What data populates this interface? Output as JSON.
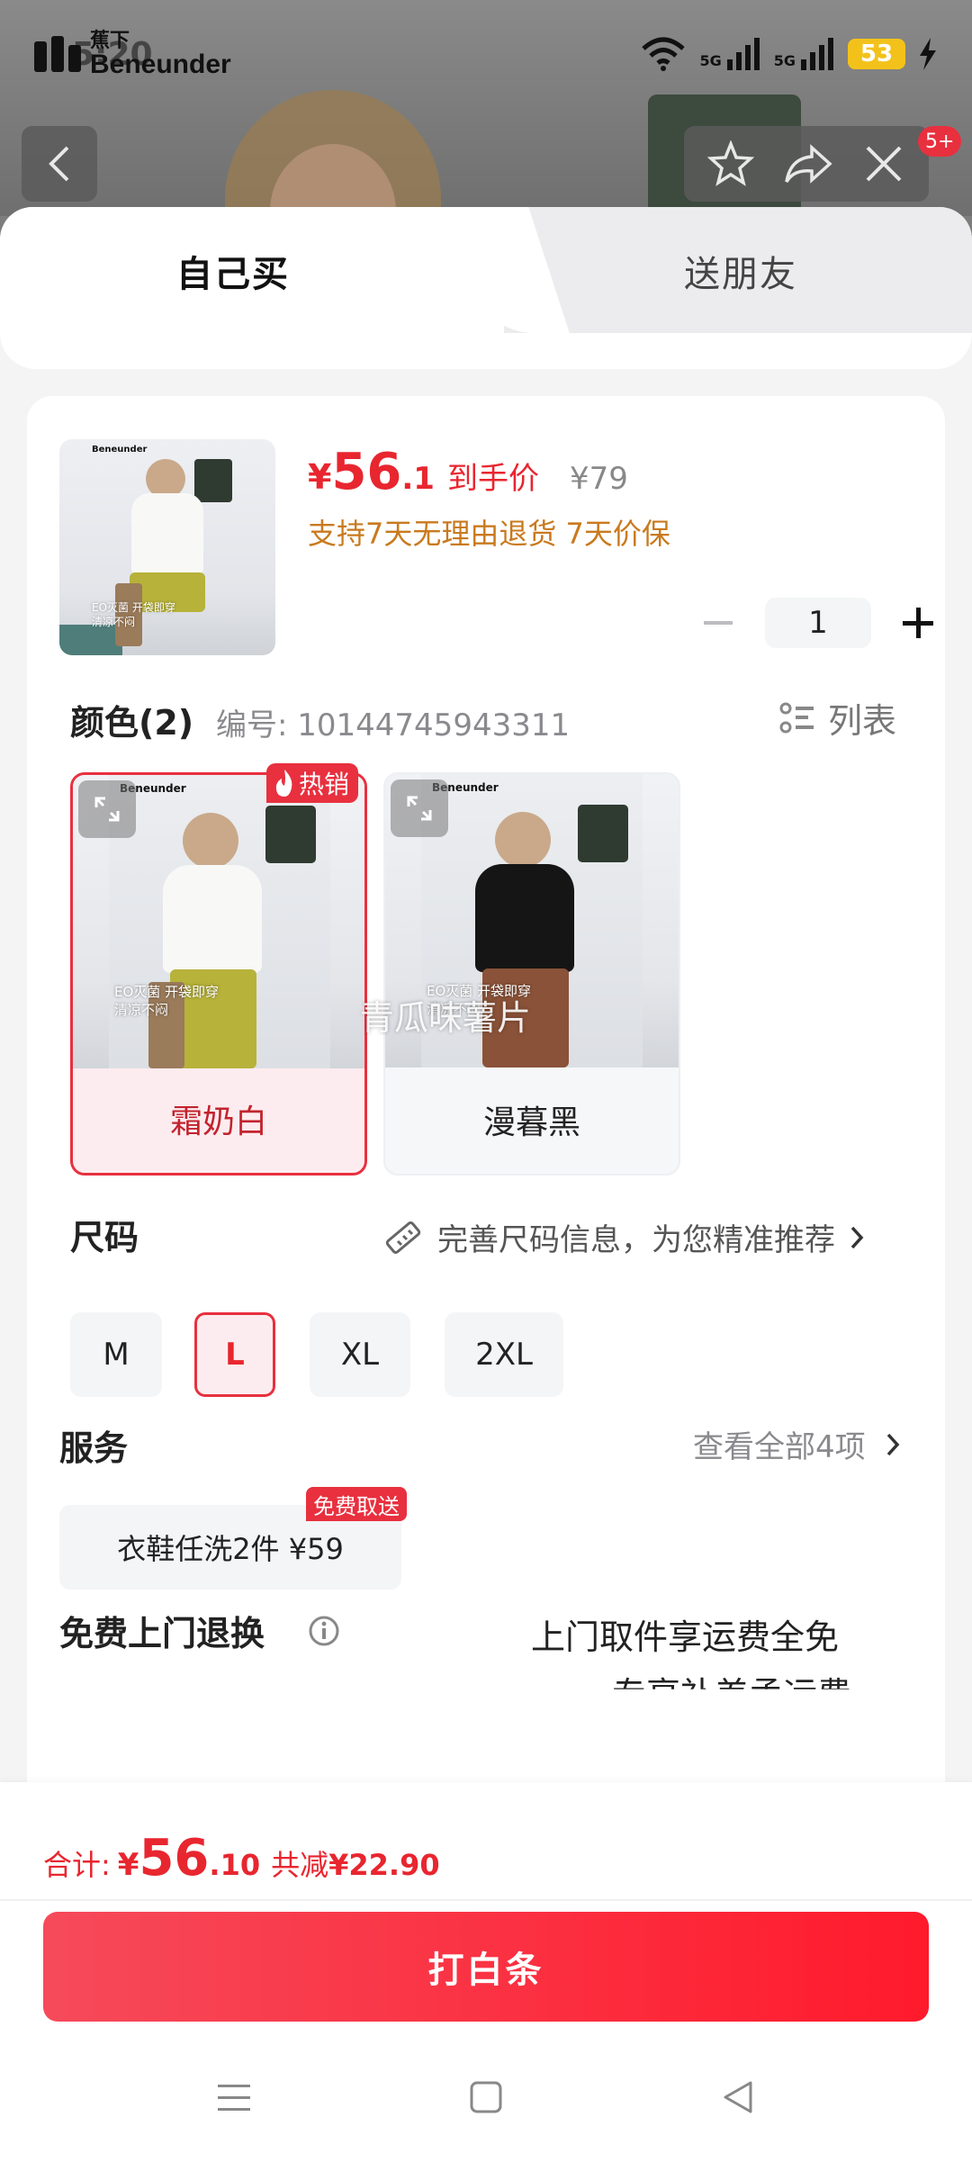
{
  "status_bar": {
    "time": "5:20",
    "brand_cn": "蕉下",
    "brand_en": "Beneunder",
    "network_1": "5G",
    "network_2": "5G",
    "battery": "53"
  },
  "top_actions": {
    "back_icon": "chevron-left-icon",
    "favorite_icon": "star-icon",
    "share_icon": "share-icon",
    "more_icon": "more-icon",
    "close_icon": "close-icon",
    "badge": "5+"
  },
  "tabs": [
    {
      "label": "自己买",
      "active": true
    },
    {
      "label": "送朋友",
      "active": false
    }
  ],
  "product": {
    "currency": "¥",
    "price_int": "56",
    "price_dec": ".1",
    "price_tag": "到手价",
    "original_price": "¥79",
    "guarantee": "支持7天无理由退货 7天价保",
    "quantity": "1",
    "thumb_caption": "EO灭菌 开袋即穿\n清凉不闷"
  },
  "color": {
    "title": "颜色(2)",
    "sku": "编号: 10144745943311",
    "list_label": "列表",
    "hot_badge": "热销",
    "overlay": "青瓜味薯片",
    "options": [
      {
        "name": "霜奶白",
        "selected": true,
        "shirt": "#f8f8f6",
        "pants": "#b7b23a",
        "caption": "EO灭菌 开袋即穿\n清凉不闷"
      },
      {
        "name": "漫暮黑",
        "selected": false,
        "shirt": "#151515",
        "pants": "#8a5238",
        "caption": "EO灭菌 开袋即穿\n清凉不闷"
      }
    ]
  },
  "size": {
    "title": "尺码",
    "hint": "完善尺码信息，为您精准推荐",
    "options": [
      {
        "label": "M",
        "selected": false
      },
      {
        "label": "L",
        "selected": true
      },
      {
        "label": "XL",
        "selected": false
      },
      {
        "label": "2XL",
        "selected": false
      }
    ]
  },
  "service": {
    "title": "服务",
    "view_all": "查看全部4项",
    "chip": "衣鞋任洗2件 ¥59",
    "chip_badge": "免费取送"
  },
  "returns": {
    "title": "免费上门退换",
    "line1": "上门取件享运费全免",
    "line2": "专享补差孟运费"
  },
  "footer": {
    "total_label": "合计:",
    "currency": "¥",
    "total_int": "56",
    "total_dec": ".10",
    "discount_label": "共减",
    "discount_value": "¥22.90",
    "buy_label": "打白条"
  },
  "colors": {
    "accent": "#e8303f",
    "price": "#e8262f",
    "guarantee": "#c97a1e"
  }
}
